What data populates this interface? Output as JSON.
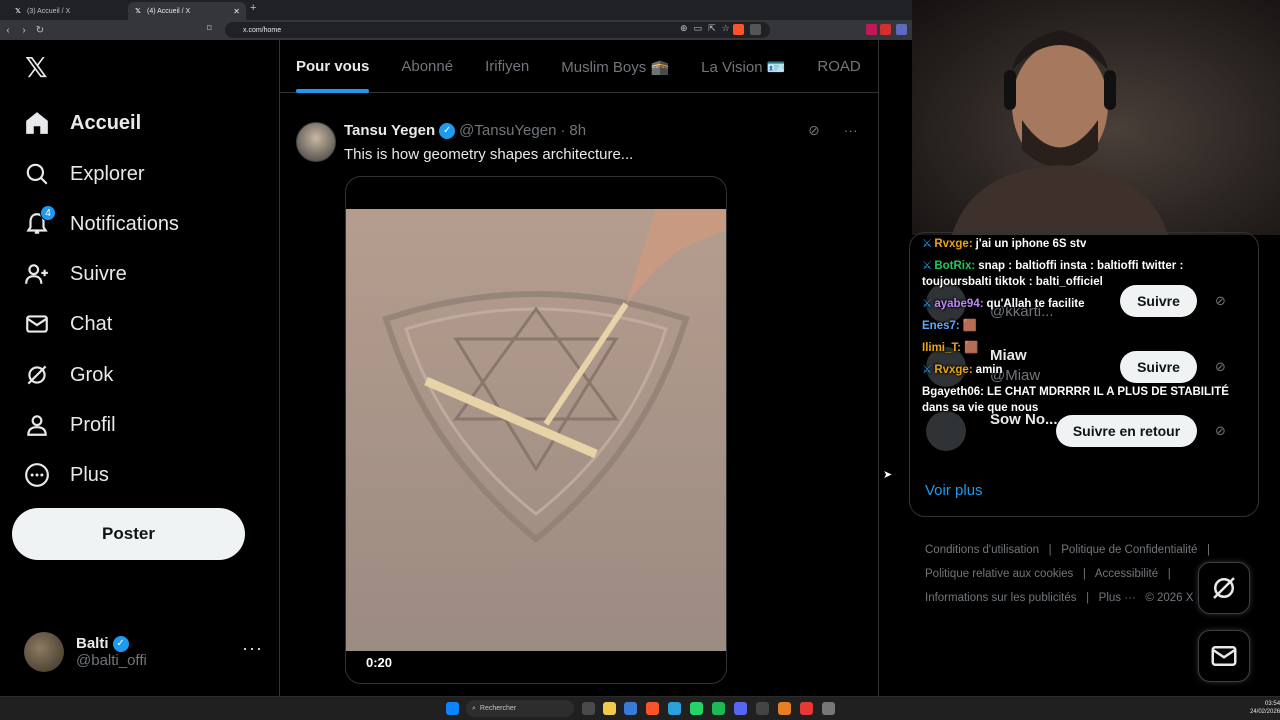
{
  "browser": {
    "tabs": [
      {
        "title": "(3) Accueil / X",
        "active": false
      },
      {
        "title": "(4) Accueil / X",
        "active": true
      }
    ],
    "url": "x.com/home"
  },
  "nav": {
    "items": [
      {
        "label": "Accueil",
        "icon": "home-icon",
        "active": true
      },
      {
        "label": "Explorer",
        "icon": "search-icon"
      },
      {
        "label": "Notifications",
        "icon": "bell-icon",
        "badge": "4"
      },
      {
        "label": "Suivre",
        "icon": "add-user-icon"
      },
      {
        "label": "Chat",
        "icon": "mail-icon"
      },
      {
        "label": "Grok",
        "icon": "grok-icon"
      },
      {
        "label": "Profil",
        "icon": "user-icon"
      },
      {
        "label": "Plus",
        "icon": "more-circle-icon"
      }
    ],
    "post_label": "Poster",
    "account": {
      "name": "Balti",
      "handle": "@balti_offi",
      "more": "···"
    }
  },
  "feed": {
    "tabs": [
      "Pour vous",
      "Abonné",
      "Irifiyen",
      "Muslim Boys 🕋",
      "La Vision 🪪",
      "ROAD"
    ],
    "tweet": {
      "name": "Tansu Yegen",
      "handle": "@TansuYegen",
      "separator": "·",
      "time": "8h",
      "text": "This is how geometry shapes architecture...",
      "video_time": "0:20"
    }
  },
  "right": {
    "suggestions": [
      {
        "name": "",
        "handle": "@kkarti...",
        "follow": "Suivre"
      },
      {
        "name": "Miaw",
        "handle": "@Miaw",
        "follow": "Suivre"
      },
      {
        "name": "Sow No...",
        "handle": "",
        "follow": "Suivre en retour"
      }
    ],
    "voir_plus": "Voir plus",
    "footer": [
      "Conditions d'utilisation",
      "|",
      "Politique de Confidentialité",
      "|",
      "Politique relative aux cookies",
      "|",
      "Accessibilité",
      "|",
      "Informations sur les publicités",
      "|",
      "Plus ···",
      "© 2026 X"
    ]
  },
  "chat": [
    {
      "user": "Rvxge:",
      "text": "j'ai un iphone 6S stv",
      "color": "#e8a317"
    },
    {
      "user": "BotRix:",
      "text": "snap : baltioffi insta : baltioffi twitter : toujoursbalti tiktok : balti_officiel",
      "color": "#22c55e"
    },
    {
      "user": "ayabe94:",
      "text": "qu'Allah te facilite",
      "color": "#c084fc"
    },
    {
      "user": "Enes7:",
      "text": "",
      "color": "#60a5fa"
    },
    {
      "user": "Ilimi_T:",
      "text": "",
      "color": "#e8a317"
    },
    {
      "user": "Rvxge:",
      "text": "amin",
      "color": "#e8a317"
    },
    {
      "user": "Bgayeth06:",
      "text": "LE CHAT MDRRRR IL A PLUS DE STABILITÉ dans sa vie que nous",
      "color": "#ffffff"
    }
  ],
  "taskbar": {
    "search_placeholder": "Rechercher",
    "time": "03:54",
    "date": "24/02/2026"
  },
  "colors": {
    "accent": "#1d9bf0",
    "bg": "#000000",
    "border": "#2f3336",
    "muted": "#71767b"
  }
}
